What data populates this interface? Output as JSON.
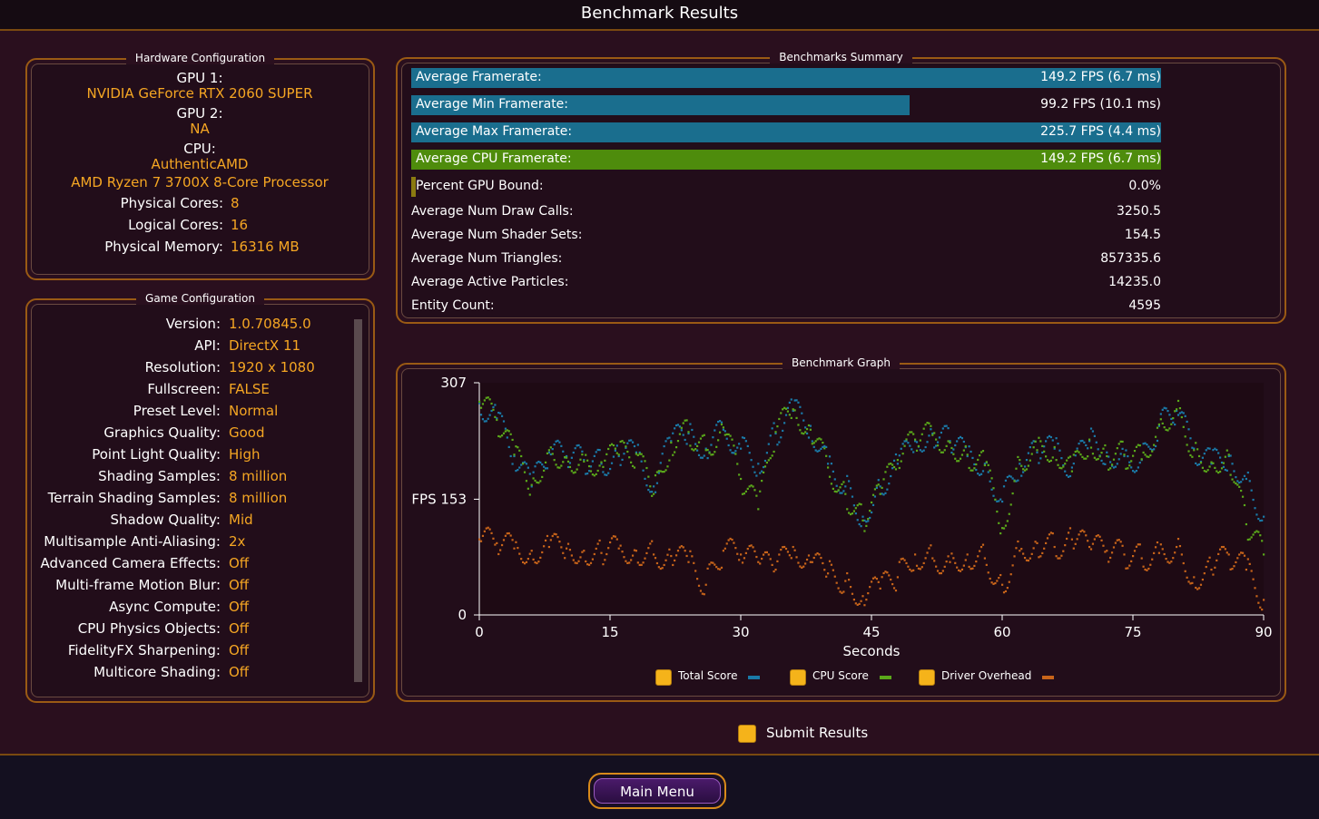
{
  "header": {
    "title": "Benchmark Results"
  },
  "hardware": {
    "title": "Hardware Configuration",
    "gpu1_label": "GPU 1:",
    "gpu1_value": "NVIDIA GeForce RTX 2060 SUPER",
    "gpu2_label": "GPU 2:",
    "gpu2_value": "NA",
    "cpu_label": "CPU:",
    "cpu_vendor": "AuthenticAMD",
    "cpu_model": "AMD Ryzen 7 3700X 8-Core Processor",
    "rows": [
      {
        "label": "Physical Cores:",
        "value": "8"
      },
      {
        "label": "Logical Cores:",
        "value": "16"
      },
      {
        "label": "Physical Memory:",
        "value": "16316  MB"
      }
    ]
  },
  "game": {
    "title": "Game Configuration",
    "rows": [
      {
        "label": "Version:",
        "value": "1.0.70845.0"
      },
      {
        "label": "API:",
        "value": "DirectX 11"
      },
      {
        "label": "Resolution:",
        "value": "1920 x 1080"
      },
      {
        "label": "Fullscreen:",
        "value": "FALSE"
      },
      {
        "label": "Preset Level:",
        "value": "Normal"
      },
      {
        "label": "Graphics Quality:",
        "value": "Good"
      },
      {
        "label": "Point Light Quality:",
        "value": "High"
      },
      {
        "label": "Shading Samples:",
        "value": "8 million"
      },
      {
        "label": "Terrain Shading Samples:",
        "value": "8 million"
      },
      {
        "label": "Shadow Quality:",
        "value": "Mid"
      },
      {
        "label": "Multisample Anti-Aliasing:",
        "value": "2x"
      },
      {
        "label": "Advanced Camera Effects:",
        "value": "Off"
      },
      {
        "label": "Multi-frame Motion Blur:",
        "value": "Off"
      },
      {
        "label": "Async Compute:",
        "value": "Off"
      },
      {
        "label": "CPU Physics Objects:",
        "value": "Off"
      },
      {
        "label": "FidelityFX Sharpening:",
        "value": "Off"
      },
      {
        "label": "Multicore Shading:",
        "value": "Off"
      }
    ]
  },
  "summary": {
    "title": "Benchmarks Summary",
    "bars": [
      {
        "label": "Average Framerate:",
        "value": "149.2 FPS (6.7 ms)",
        "fill": 1.0,
        "color": "#1a6e8e"
      },
      {
        "label": "Average Min Framerate:",
        "value": "99.2 FPS (10.1 ms)",
        "fill": 0.665,
        "color": "#1a6e8e"
      },
      {
        "label": "Average Max Framerate:",
        "value": "225.7 FPS (4.4 ms)",
        "fill": 1.0,
        "color": "#1a6e8e"
      },
      {
        "label": "Average CPU Framerate:",
        "value": "149.2 FPS (6.7 ms)",
        "fill": 1.0,
        "color": "#4e8c0c"
      },
      {
        "label": "Percent GPU Bound:",
        "value": "0.0%",
        "fill": 0.0,
        "color": "#8a7a10"
      }
    ],
    "stats": [
      {
        "label": "Average Num Draw Calls:",
        "value": "3250.5"
      },
      {
        "label": "Average Num Shader Sets:",
        "value": "154.5"
      },
      {
        "label": "Average Num Triangles:",
        "value": "857335.6"
      },
      {
        "label": "Average Active Particles:",
        "value": "14235.0"
      },
      {
        "label": "Entity Count:",
        "value": "4595"
      }
    ]
  },
  "graph": {
    "title": "Benchmark Graph",
    "legend": [
      {
        "label": "Total Score",
        "color": "#1a7aa8"
      },
      {
        "label": "CPU Score",
        "color": "#5aa81a"
      },
      {
        "label": "Driver Overhead",
        "color": "#c8641a"
      }
    ]
  },
  "chart_data": {
    "type": "scatter",
    "title": "",
    "xlabel": "Seconds",
    "ylabel": "FPS",
    "xlim": [
      0,
      90
    ],
    "ylim": [
      0,
      307
    ],
    "x_ticks": [
      "0",
      "15",
      "30",
      "45",
      "60",
      "75",
      "90"
    ],
    "y_ticks": [
      "307",
      "FPS 153",
      "0"
    ],
    "series": [
      {
        "name": "Total Score",
        "color": "#1a7aa8",
        "x": [
          0,
          2,
          4,
          6,
          8,
          10,
          12,
          14,
          16,
          18,
          20,
          22,
          24,
          26,
          28,
          30,
          32,
          34,
          36,
          38,
          40,
          42,
          44,
          46,
          48,
          50,
          52,
          54,
          56,
          58,
          60,
          62,
          64,
          66,
          68,
          70,
          72,
          74,
          76,
          78,
          80,
          82,
          84,
          86,
          88,
          90
        ],
        "y": [
          280,
          260,
          210,
          170,
          215,
          210,
          205,
          200,
          210,
          215,
          170,
          230,
          240,
          220,
          245,
          220,
          200,
          240,
          270,
          250,
          200,
          170,
          130,
          170,
          200,
          230,
          240,
          230,
          210,
          200,
          150,
          200,
          215,
          220,
          195,
          230,
          215,
          210,
          205,
          250,
          270,
          220,
          200,
          210,
          180,
          130
        ]
      },
      {
        "name": "CPU Score",
        "color": "#5aa81a",
        "x": [
          0,
          2,
          4,
          6,
          8,
          10,
          12,
          14,
          16,
          18,
          20,
          22,
          24,
          26,
          28,
          30,
          32,
          34,
          36,
          38,
          40,
          42,
          44,
          46,
          48,
          50,
          52,
          54,
          56,
          58,
          60,
          62,
          64,
          66,
          68,
          70,
          72,
          74,
          76,
          78,
          80,
          82,
          84,
          86,
          88,
          90
        ],
        "y": [
          282,
          258,
          212,
          172,
          218,
          208,
          203,
          202,
          212,
          213,
          160,
          228,
          242,
          218,
          248,
          180,
          140,
          242,
          272,
          245,
          195,
          160,
          125,
          160,
          205,
          232,
          238,
          228,
          212,
          198,
          115,
          205,
          218,
          222,
          190,
          232,
          210,
          212,
          206,
          252,
          272,
          218,
          202,
          212,
          120,
          80
        ]
      },
      {
        "name": "Driver Overhead",
        "color": "#c8641a",
        "x": [
          0,
          2,
          4,
          6,
          8,
          10,
          12,
          14,
          16,
          18,
          20,
          22,
          24,
          26,
          28,
          30,
          32,
          34,
          36,
          38,
          40,
          42,
          44,
          46,
          48,
          50,
          52,
          54,
          56,
          58,
          60,
          62,
          64,
          66,
          68,
          70,
          72,
          74,
          76,
          78,
          80,
          82,
          84,
          86,
          88,
          90
        ],
        "y": [
          100,
          95,
          88,
          85,
          90,
          88,
          85,
          82,
          88,
          85,
          80,
          78,
          70,
          40,
          85,
          80,
          70,
          60,
          90,
          70,
          55,
          45,
          25,
          35,
          50,
          80,
          75,
          70,
          80,
          75,
          40,
          85,
          95,
          90,
          100,
          90,
          85,
          80,
          75,
          82,
          90,
          50,
          60,
          80,
          60,
          20
        ]
      }
    ]
  },
  "submit": {
    "label": "Submit Results"
  },
  "footer": {
    "main_menu_label": "Main Menu"
  }
}
